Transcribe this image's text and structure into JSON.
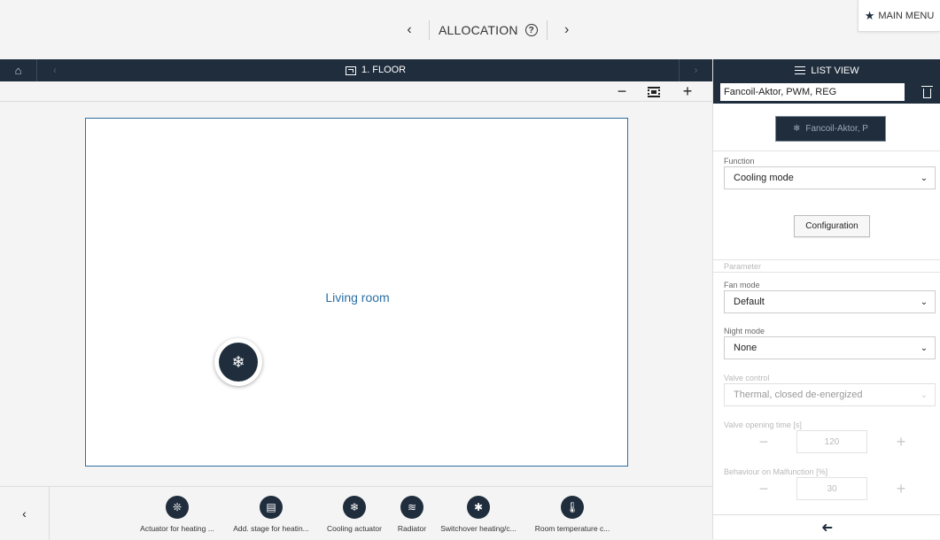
{
  "header": {
    "title": "ALLOCATION",
    "help_icon": "?",
    "prev_icon": "‹",
    "next_icon": "›",
    "main_menu_label": "MAIN MENU"
  },
  "floor": {
    "label": "1. FLOOR"
  },
  "zoom": {
    "minus": "−",
    "plus": "+"
  },
  "room": {
    "label": "Living room"
  },
  "devices_bar": {
    "back_icon": "‹",
    "items": [
      {
        "label": "Actuator for heating ...",
        "icon": "❊"
      },
      {
        "label": "Add. stage for heatin...",
        "icon": "▤"
      },
      {
        "label": "Cooling actuator",
        "icon": "❄"
      },
      {
        "label": "Radiator",
        "icon": "≋"
      },
      {
        "label": "Switchover heating/c...",
        "icon": "✱"
      },
      {
        "label": "Room temperature c...",
        "icon": "🌡"
      }
    ]
  },
  "list_view": {
    "title": "LIST VIEW",
    "name_value": "Fancoil-Aktor, PWM, REG",
    "device_button": "Fancoil-Aktor, P",
    "function_label": "Function",
    "function_value": "Cooling mode",
    "config_button": "Configuration",
    "parameter_label": "Parameter",
    "fan_mode_label": "Fan mode",
    "fan_mode_value": "Default",
    "night_mode_label": "Night mode",
    "night_mode_value": "None",
    "valve_control_label": "Valve control",
    "valve_control_value": "Thermal, closed de-energized",
    "valve_opening_label": "Valve opening time [s]",
    "valve_opening_value": "120",
    "malfunction_label": "Behaviour on Malfunction [%]",
    "malfunction_value": "30"
  },
  "colors": {
    "dark": "#1f2d3d",
    "accent": "#2b6fa3",
    "bg": "#f4f4f4"
  }
}
